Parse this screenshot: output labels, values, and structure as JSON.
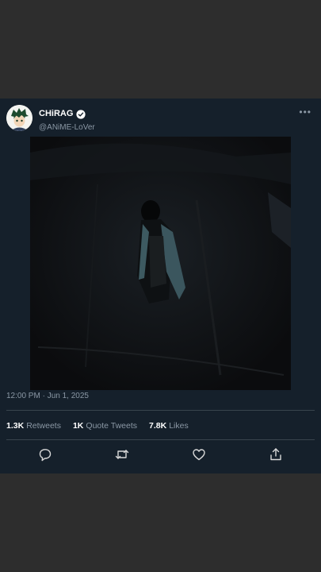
{
  "tweet": {
    "display_name": "CHiRAG",
    "handle": "@ANiME-LoVer",
    "verified": true,
    "timestamp": "12:00 PM · Jun 1, 2025"
  },
  "stats": {
    "retweets_count": "1.3K",
    "retweets_label": "Retweets",
    "quotes_count": "1K",
    "quotes_label": "Quote Tweets",
    "likes_count": "7.8K",
    "likes_label": "Likes"
  },
  "icons": {
    "more": "more-icon",
    "reply": "reply-icon",
    "retweet": "retweet-icon",
    "like": "like-icon",
    "share": "share-icon"
  },
  "colors": {
    "card_bg": "#15202b",
    "page_bg": "#2d2d2d",
    "secondary_text": "#8b98a5",
    "verified": "#ffffff"
  }
}
